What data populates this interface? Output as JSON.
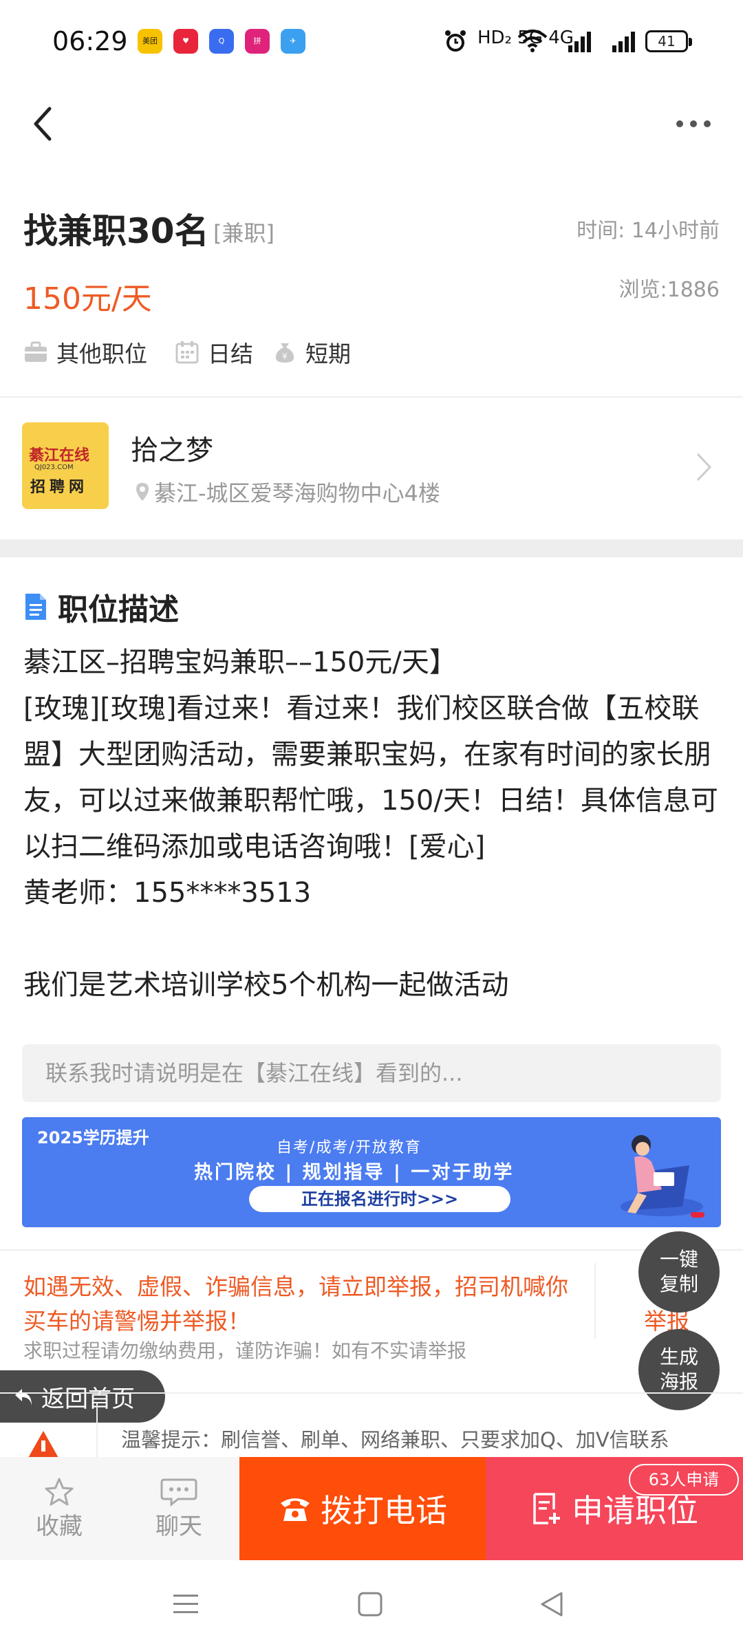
{
  "status_bar": {
    "time": "06:29",
    "apps": [
      {
        "name": "美团",
        "color": "#f7c200",
        "fg": "#222"
      },
      {
        "name": "♥",
        "color": "#e8253a",
        "fg": "#fff"
      },
      {
        "name": "Q",
        "color": "#3a6cf0",
        "fg": "#fff"
      },
      {
        "name": "拼",
        "color": "#e0237a",
        "fg": "#fff"
      },
      {
        "name": "✈",
        "color": "#3ba0f0",
        "fg": "#fff"
      }
    ],
    "network": "HD₂  5G  4G",
    "battery": "41"
  },
  "job": {
    "title": "找兼职30名",
    "type": "[兼职]",
    "time": "时间: 14小时前",
    "salary": "150元/天",
    "views": "浏览:1886",
    "tags": [
      "其他职位",
      "日结",
      "短期"
    ]
  },
  "company": {
    "logo_line1": "綦江在线",
    "logo_line2": "QJ023.COM",
    "logo_line3": "招聘网",
    "name": "拾之梦",
    "address": "綦江-城区爱琴海购物中心4楼"
  },
  "description": {
    "section_title": "职位描述",
    "text": "綦江区–招聘宝妈兼职––150元/天】\n[玫瑰][玫瑰]看过来！看过来！我们校区联合做【五校联盟】大型团购活动，需要兼职宝妈，在家有时间的家长朋友，可以过来做兼职帮忙哦，150/天！日结！具体信息可以扫二维码添加或电话咨询哦！[爱心]\n黄老师：155****3513\n\n我们是艺术培训学校5个机构一起做活动"
  },
  "contact_note": "联系我时请说明是在【綦江在线】看到的...",
  "banner": {
    "tag": "2025学历提升",
    "line1": "自考/成考/开放教育",
    "line2": "热门院校 | 规划指导 | 一对于助学",
    "button": "正在报名进行时>>>"
  },
  "warning": {
    "text": "如遇无效、虚假、诈骗信息，请立即举报，招司机喊你买车的请警惕并举报！",
    "sub": "求职过程请勿缴纳费用，谨防诈骗！如有不实请举报",
    "report": "举报"
  },
  "fabs": {
    "copy": "一键\n复制",
    "poster": "生成\n海报"
  },
  "home_button": "返回首页",
  "tip": "温馨提示：刷信誉、刷单、网络兼职、只要求加Q、加V信联系",
  "bottom": {
    "favorite": "收藏",
    "chat": "聊天",
    "call": "拨打电话",
    "apply": "申请职位",
    "apply_count": "63人申请"
  },
  "colors": {
    "accent": "#ee5a24",
    "call": "#ff4d0a",
    "apply": "#f5465a",
    "banner": "#4b7cf0"
  }
}
